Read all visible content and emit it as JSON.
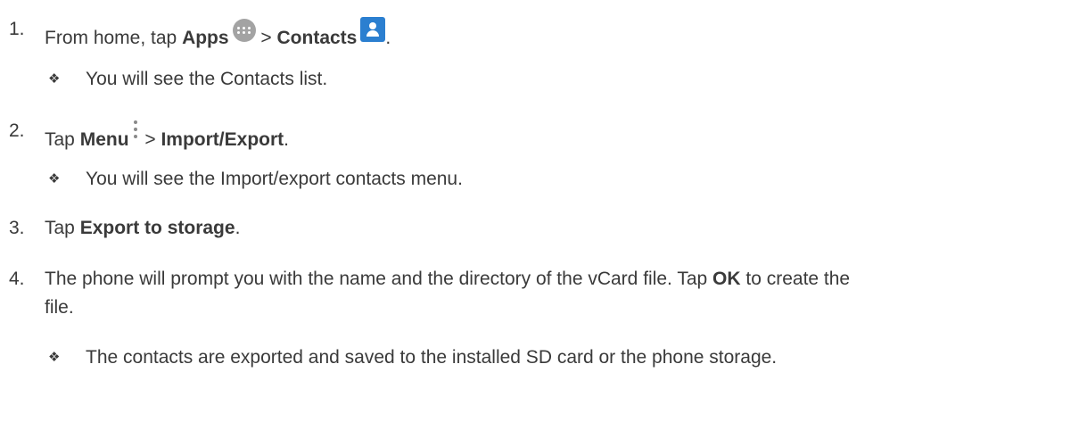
{
  "steps": [
    {
      "number": "1.",
      "parts": {
        "pre": "From home, tap ",
        "bold1": "Apps",
        "sep": " > ",
        "bold2": "Contacts",
        "post": "."
      },
      "icons": [
        "apps-icon",
        "contacts-icon"
      ],
      "note": "You will see the Contacts list."
    },
    {
      "number": "2.",
      "parts": {
        "pre": "Tap ",
        "bold1": "Menu",
        "sep": " > ",
        "bold2": "Import/Export",
        "post": "."
      },
      "icons": [
        "menu-icon"
      ],
      "note": "You will see the Import/export contacts menu."
    },
    {
      "number": "3.",
      "parts": {
        "pre": "Tap ",
        "bold1": "Export to storage",
        "post": "."
      }
    },
    {
      "number": "4.",
      "parts": {
        "line1_pre": "The phone will prompt you with the name and the directory of the vCard file. Tap ",
        "bold1": "OK",
        "line1_post": " to create the",
        "line2": "file."
      },
      "note": "The contacts are exported and saved to the installed SD card or the phone storage."
    }
  ],
  "bullet_glyph": "❖"
}
